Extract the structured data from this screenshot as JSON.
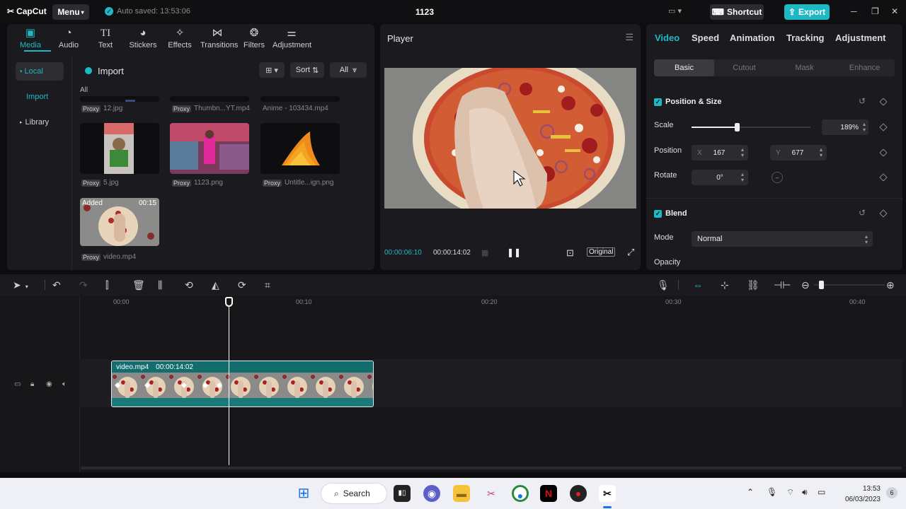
{
  "app": {
    "logo": "CapCut",
    "menu_label": "Menu",
    "autosave": "Auto saved: 13:53:06",
    "project_title": "1123",
    "shortcut_label": "Shortcut",
    "export_label": "Export"
  },
  "media_toolbar": [
    {
      "label": "Media",
      "icon": "media-icon"
    },
    {
      "label": "Audio",
      "icon": "audio-icon"
    },
    {
      "label": "Text",
      "icon": "text-icon"
    },
    {
      "label": "Stickers",
      "icon": "stickers-icon"
    },
    {
      "label": "Effects",
      "icon": "effects-icon"
    },
    {
      "label": "Transitions",
      "icon": "transitions-icon"
    },
    {
      "label": "Filters",
      "icon": "filters-icon"
    },
    {
      "label": "Adjustment",
      "icon": "adjustment-icon"
    }
  ],
  "media_sidebar": {
    "local": "Local",
    "import": "Import",
    "library": "Library"
  },
  "media_header": {
    "import_label": "Import",
    "sort_label": "Sort",
    "all_label": "All",
    "filter_all": "All"
  },
  "media_items": [
    {
      "name": "12.jpg",
      "proxy": "Proxy"
    },
    {
      "name": "Thumbn...YT.mp4",
      "proxy": "Proxy"
    },
    {
      "name": "Anime - 103434.mp4",
      "proxy": ""
    },
    {
      "name": "5.jpg",
      "proxy": "Proxy"
    },
    {
      "name": "1123.png",
      "proxy": "Proxy"
    },
    {
      "name": "Untitle...ign.png",
      "proxy": "Proxy"
    },
    {
      "name": "video.mp4",
      "proxy": "Proxy",
      "badge": "Added",
      "duration": "00:15"
    }
  ],
  "player": {
    "title": "Player",
    "current_time": "00:00:06:10",
    "total_time": "00:00:14:02",
    "original_label": "Original"
  },
  "inspector": {
    "tabs": [
      "Video",
      "Speed",
      "Animation",
      "Tracking",
      "Adjustment"
    ],
    "subtabs": [
      "Basic",
      "Cutout",
      "Mask",
      "Enhance"
    ],
    "position_size_title": "Position & Size",
    "scale_label": "Scale",
    "scale_value": "189%",
    "scale_fraction": 0.38,
    "position_label": "Position",
    "x_label": "X",
    "x_value": "167",
    "y_label": "Y",
    "y_value": "677",
    "rotate_label": "Rotate",
    "rotate_value": "0°",
    "blend_title": "Blend",
    "mode_label": "Mode",
    "mode_value": "Normal",
    "opacity_label": "Opacity"
  },
  "timeline": {
    "ruler": [
      "00:00",
      "00:10",
      "00:20",
      "00:30",
      "00:40"
    ],
    "clip_name": "video.mp4",
    "clip_duration": "00:00:14:02"
  },
  "taskbar": {
    "search_label": "Search",
    "time": "13:53",
    "date": "06/03/2023",
    "notification_count": "6"
  },
  "colors": {
    "accent": "#1fb9c6",
    "panel": "#1b1b1f",
    "background": "#0d0d0f"
  }
}
